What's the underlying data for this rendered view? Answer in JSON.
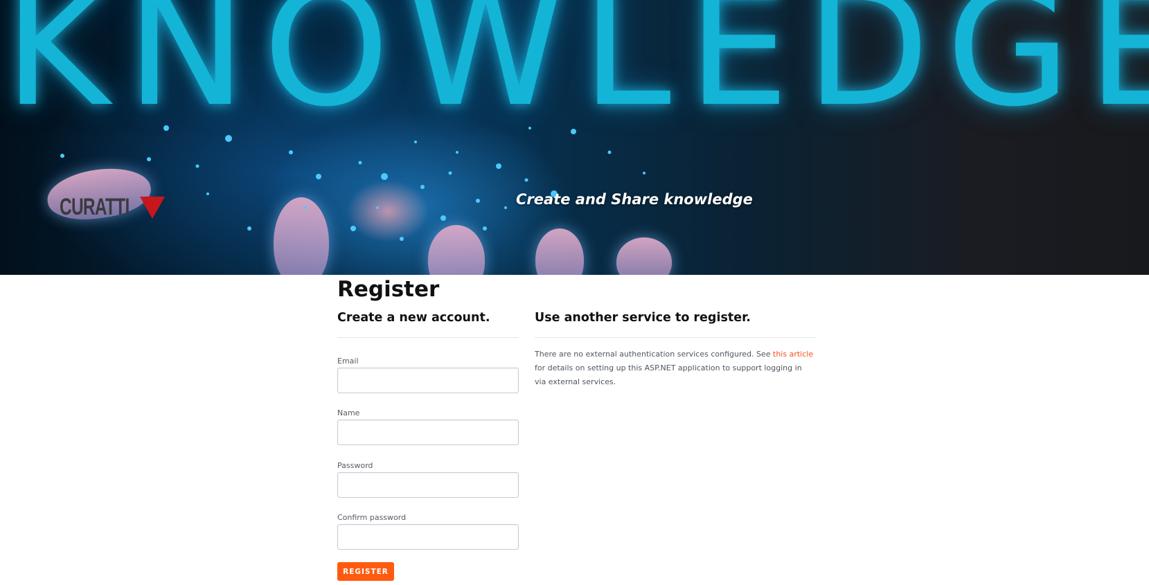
{
  "header": {
    "banner_word": "KNOWLEDGE",
    "logo_text": "CURATTI",
    "tagline": "Create and Share knowledge"
  },
  "page": {
    "title": "Register"
  },
  "register_form": {
    "heading": "Create a new account.",
    "fields": [
      {
        "label": "Email",
        "value": ""
      },
      {
        "label": "Name",
        "value": ""
      },
      {
        "label": "Password",
        "value": ""
      },
      {
        "label": "Confirm password",
        "value": ""
      }
    ],
    "submit_label": "REGISTER"
  },
  "external": {
    "heading": "Use another service to register.",
    "text_before": "There are no external authentication services configured. See ",
    "link_text": "this article",
    "text_after": " for details on setting up this ASP.NET application to support logging in via external services."
  },
  "colors": {
    "accent": "#ff5b0e",
    "link": "#f4511e",
    "banner_text": "#14b4d6"
  }
}
